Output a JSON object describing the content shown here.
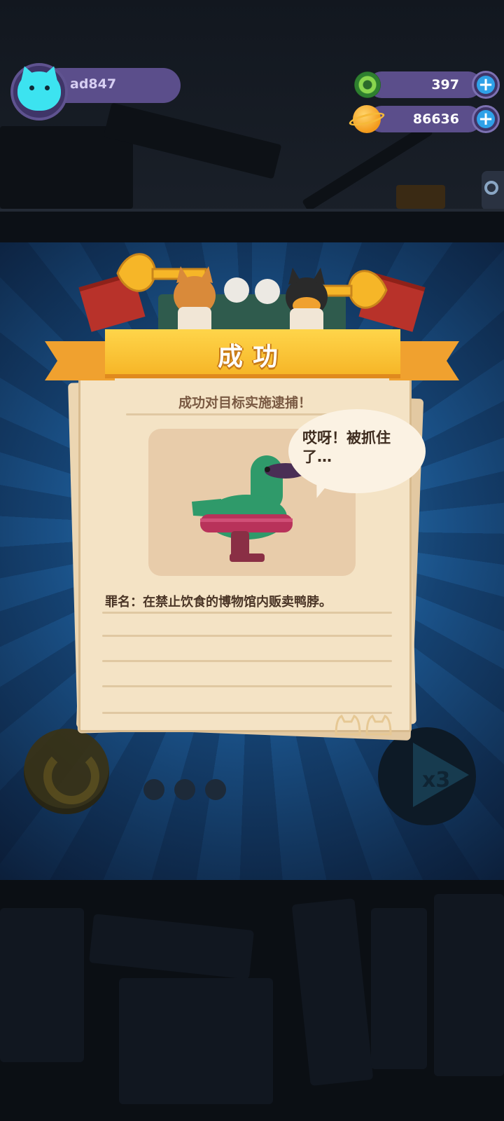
{
  "header": {
    "username": "ad847"
  },
  "currencies": [
    {
      "name": "donut",
      "value": "397",
      "icon": "donut-icon"
    },
    {
      "name": "planet-coin",
      "value": "86636",
      "icon": "planet-coin-icon"
    }
  ],
  "result_dialog": {
    "title": "成功",
    "subtitle": "成功对目标实施逮捕！",
    "speech": "哎呀！被抓住了…",
    "crime": "罪名：在禁止饮食的博物馆内贩卖鸭脖。"
  },
  "background_controls": {
    "speed_label": "x3"
  },
  "colors": {
    "banner": "#f6b628",
    "paper": "#f4e3c5",
    "hud_bar": "#5b4e8b",
    "plus_button": "#2fa1e8",
    "duck_body": "#2f9a6a",
    "duck_ring": "#b8325a"
  }
}
